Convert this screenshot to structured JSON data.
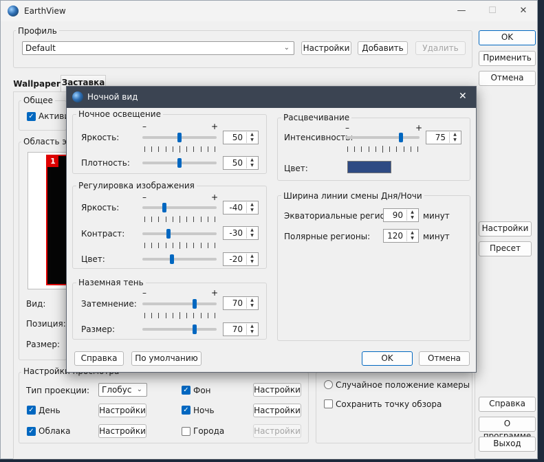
{
  "window": {
    "title": "EarthView",
    "min": "—",
    "max": "☐",
    "close": "✕"
  },
  "profile": {
    "group_label": "Профиль",
    "selected": "Default",
    "settings_btn": "Настройки",
    "add_btn": "Добавить",
    "delete_btn": "Удалить"
  },
  "right_buttons": {
    "ok": "OK",
    "apply": "Применить",
    "cancel": "Отмена",
    "settings": "Настройки",
    "preset": "Пресет",
    "help": "Справка",
    "about": "О программе",
    "exit": "Выход"
  },
  "tabs": {
    "wallpaper": "Wallpaper",
    "screensaver": "Заставка"
  },
  "general": {
    "label": "Общее",
    "activate": "Активир"
  },
  "screen_area": {
    "label": "Область экр",
    "monitor_number": "1"
  },
  "view_labels": {
    "view": "Вид:",
    "position": "Позиция:",
    "size": "Размер:"
  },
  "preview": {
    "label": "Настройки просмотра",
    "projection_type_label": "Тип проекции:",
    "projection_value": "Глобус",
    "day": "День",
    "clouds": "Облака",
    "background": "Фон",
    "night": "Ночь",
    "cities": "Города",
    "settings": "Настройки"
  },
  "camera": {
    "random_position": "Случайное положение камеры",
    "save_viewpoint": "Сохранить точку обзора"
  },
  "dialog": {
    "title": "Ночной вид",
    "close": "✕",
    "night_light": {
      "label": "Ночное освещение",
      "brightness_label": "Яркость:",
      "brightness": "50",
      "density_label": "Плотность:",
      "density": "50"
    },
    "image_adjust": {
      "label": "Регулировка изображения",
      "brightness_label": "Яркость:",
      "brightness": "-40",
      "contrast_label": "Контраст:",
      "contrast": "-30",
      "color_label": "Цвет:",
      "color": "-20"
    },
    "ground_shadow": {
      "label": "Наземная тень",
      "dimming_label": "Затемнение:",
      "dimming": "70",
      "size_label": "Размер:",
      "size": "70"
    },
    "glow": {
      "label": "Расцвечивание",
      "intensity_label": "Интенсивность:",
      "intensity": "75",
      "color_label": "Цвет:",
      "color_hex": "#2e4a83"
    },
    "terminator": {
      "label": "Ширина линии смены Дня/Ночи",
      "equatorial_label": "Экваториальные регионы:",
      "equatorial": "90",
      "polar_label": "Полярные регионы:",
      "polar": "120",
      "unit": "минут"
    },
    "buttons": {
      "help": "Справка",
      "defaults": "По умолчанию",
      "ok": "OK",
      "cancel": "Отмена"
    }
  },
  "slider_levels": {
    "nl_brightness": 0.5,
    "nl_density": 0.5,
    "ia_brightness": 0.3,
    "ia_contrast": 0.35,
    "ia_color": 0.4,
    "gs_dimming": 0.7,
    "gs_size": 0.7,
    "glow_intensity": 0.75
  },
  "plus": "+",
  "minus": "–"
}
